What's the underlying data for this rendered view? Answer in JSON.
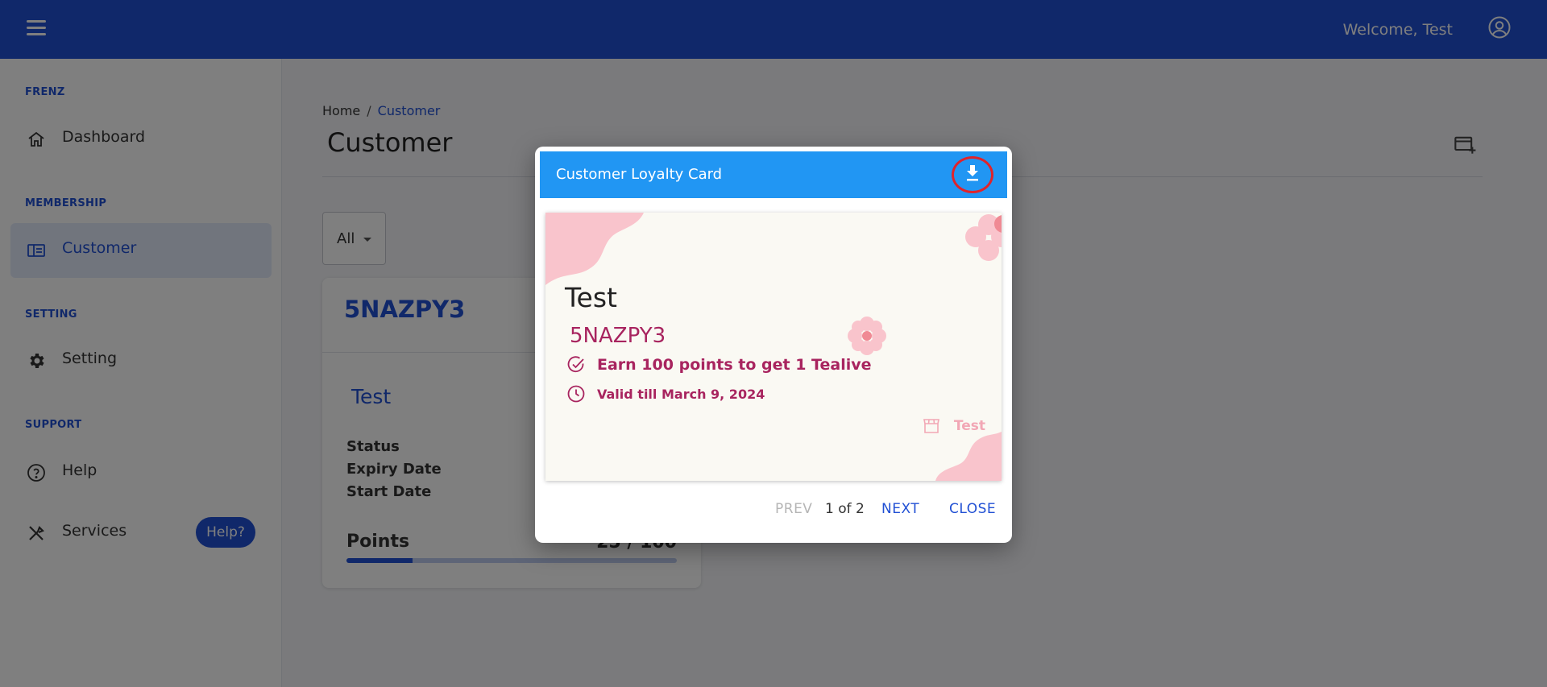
{
  "header": {
    "welcome": "Welcome, Test",
    "menu_icon": "hamburger-menu-icon",
    "account_icon": "account-circle-icon"
  },
  "sidebar": {
    "sections": [
      {
        "label": "FRENZ",
        "items": [
          {
            "label": "Dashboard",
            "icon": "home-icon"
          }
        ]
      },
      {
        "label": "MEMBERSHIP",
        "items": [
          {
            "label": "Customer",
            "icon": "card-icon",
            "active": true
          }
        ]
      },
      {
        "label": "SETTING",
        "items": [
          {
            "label": "Setting",
            "icon": "gear-icon"
          }
        ]
      },
      {
        "label": "SUPPORT",
        "items": [
          {
            "label": "Help",
            "icon": "help-circle-icon"
          },
          {
            "label": "Services",
            "icon": "tools-icon"
          }
        ]
      }
    ],
    "help_button": "Help?"
  },
  "main": {
    "breadcrumb": {
      "home": "Home",
      "separator": "/",
      "current": "Customer"
    },
    "title": "Customer",
    "filter": {
      "value": "All"
    },
    "customer_card": {
      "code": "5NAZPY3",
      "name": "Test",
      "fields": {
        "status": "Status",
        "expiry": "Expiry Date",
        "start": "Start Date"
      },
      "points_label": "Points",
      "points_value": "25 / 100",
      "points_progress": 0.2
    }
  },
  "dialog": {
    "title": "Customer Loyalty Card",
    "download_icon": "download-icon",
    "card": {
      "name": "Test",
      "code": "5NAZPY3",
      "earn_text": "Earn 100 points to get 1 Tealive",
      "valid_text": "Valid till March 9, 2024",
      "store_name": "Test",
      "colors": {
        "accent": "#a8245f",
        "blob": "#f9c4cc",
        "flower": "#f08a94"
      }
    },
    "footer": {
      "prev": "PREV",
      "page": "1 of 2",
      "next": "NEXT",
      "close": "CLOSE"
    }
  },
  "colors": {
    "primary": "#2150d4",
    "dialog_header": "#2196f3",
    "highlight_ring": "#e0232b"
  }
}
